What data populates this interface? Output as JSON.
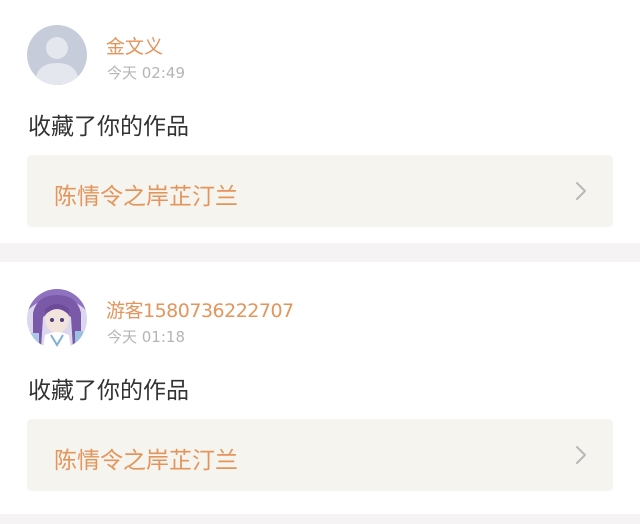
{
  "notifications": [
    {
      "username": "金文义",
      "time": "今天 02:49",
      "action": "收藏了你的作品",
      "work_title": "陈情令之岸芷汀兰",
      "avatar_icon": "default-user-icon"
    },
    {
      "username": "游客1580736222707",
      "time": "今天 01:18",
      "action": "收藏了你的作品",
      "work_title": "陈情令之岸芷汀兰",
      "avatar_icon": "anime-girl-avatar"
    }
  ],
  "colors": {
    "accent": "#e3955c",
    "muted": "#b5b5b5",
    "text": "#333333",
    "link_bg": "#f5f4ef",
    "separator": "#f5f3f3"
  }
}
